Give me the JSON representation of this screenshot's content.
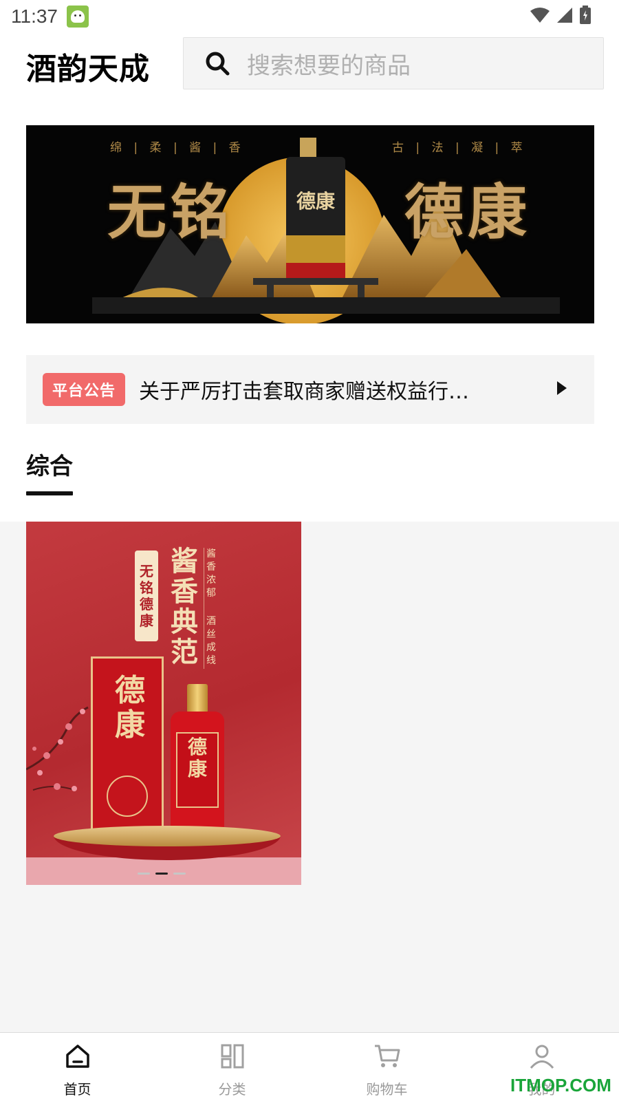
{
  "status_bar": {
    "time": "11:37"
  },
  "header": {
    "title": "酒韵天成",
    "search_placeholder": "搜索想要的商品"
  },
  "banner": {
    "tag_left": "绵 | 柔 | 酱 | 香",
    "tag_right": "古 | 法 | 凝 | 萃",
    "big_left": "无铭",
    "big_right": "德康"
  },
  "notice": {
    "badge": "平台公告",
    "text": "关于严厉打击套取商家赠送权益行…"
  },
  "tabs": [
    {
      "label": "综合",
      "active": true
    }
  ],
  "products": [
    {
      "label_vertical": "无铭德康",
      "big_vertical": "酱香典范",
      "small_vertical_a": "酱香浓郁",
      "small_vertical_b": "酒丝成线",
      "box_title": "德康",
      "bottle_title": "德康",
      "carousel_dots": 3,
      "carousel_active": 2
    }
  ],
  "bottom_nav": [
    {
      "label": "首页",
      "icon": "home-icon",
      "active": true
    },
    {
      "label": "分类",
      "icon": "grid-icon",
      "active": false
    },
    {
      "label": "购物车",
      "icon": "cart-icon",
      "active": false
    },
    {
      "label": "我的",
      "icon": "user-icon",
      "active": false
    }
  ],
  "watermark": "ITMOP.COM",
  "colors": {
    "notice_badge": "#f16a6a",
    "content_bg": "#f5f5f5",
    "watermark": "#1aa53a"
  }
}
